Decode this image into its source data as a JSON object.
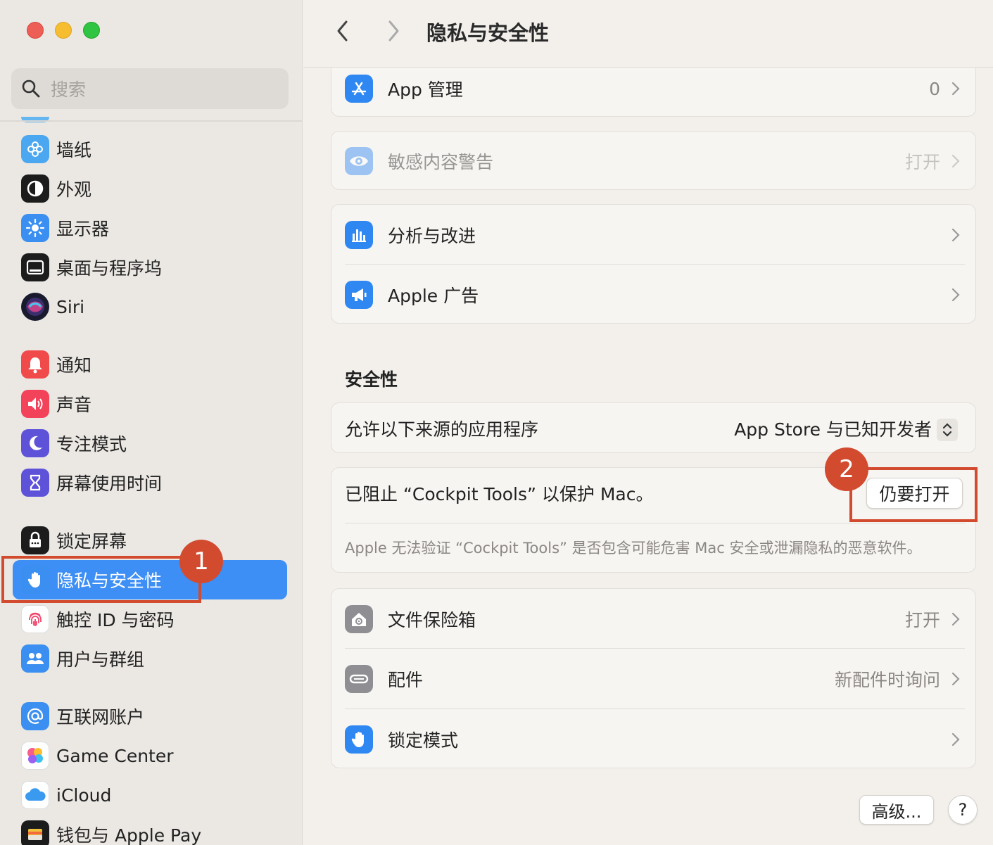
{
  "search": {
    "placeholder": "搜索"
  },
  "sidebar": {
    "items": [
      {
        "label": "墙纸",
        "icon": "wallpaper-icon",
        "color": "#4aa7f0"
      },
      {
        "label": "外观",
        "icon": "appearance-icon",
        "color": "#1c1c1c"
      },
      {
        "label": "显示器",
        "icon": "display-icon",
        "color": "#3a8ff0"
      },
      {
        "label": "桌面与程序坞",
        "icon": "desktop-dock-icon",
        "color": "#1c1c1c"
      },
      {
        "label": "Siri",
        "icon": "siri-icon",
        "color": "#2b2b40"
      },
      {
        "label": "通知",
        "icon": "bell-icon",
        "color": "#f04a4a"
      },
      {
        "label": "声音",
        "icon": "speaker-icon",
        "color": "#f2435a"
      },
      {
        "label": "专注模式",
        "icon": "moon-icon",
        "color": "#5e52d9"
      },
      {
        "label": "屏幕使用时间",
        "icon": "hourglass-icon",
        "color": "#5e52d9"
      },
      {
        "label": "锁定屏幕",
        "icon": "lock-icon",
        "color": "#1c1c1c"
      },
      {
        "label": "隐私与安全性",
        "icon": "hand-icon",
        "color": "#3a8ff0"
      },
      {
        "label": "触控 ID 与密码",
        "icon": "fingerprint-icon",
        "color": "#ffffff"
      },
      {
        "label": "用户与群组",
        "icon": "users-icon",
        "color": "#3a8ff0"
      },
      {
        "label": "互联网账户",
        "icon": "at-icon",
        "color": "#3a8ff0"
      },
      {
        "label": "Game Center",
        "icon": "game-center-icon",
        "color": "#ffffff"
      },
      {
        "label": "iCloud",
        "icon": "icloud-icon",
        "color": "#ffffff"
      },
      {
        "label": "钱包与 Apple Pay",
        "icon": "wallet-icon",
        "color": "#1c1c1c"
      }
    ]
  },
  "header": {
    "title": "隐私与安全性"
  },
  "rows": {
    "app_mgmt": {
      "label": "App 管理",
      "value": "0"
    },
    "sensitive": {
      "label": "敏感内容警告",
      "value": "打开"
    },
    "analytics": {
      "label": "分析与改进"
    },
    "apple_ads": {
      "label": "Apple 广告"
    },
    "file_vault": {
      "label": "文件保险箱",
      "value": "打开"
    },
    "accessories": {
      "label": "配件",
      "value": "新配件时询问"
    },
    "lockdown": {
      "label": "锁定模式"
    }
  },
  "security": {
    "title": "安全性",
    "allow_label": "允许以下来源的应用程序",
    "allow_value": "App Store 与已知开发者",
    "blocked_text": "已阻止 “Cockpit Tools” 以保护 Mac。",
    "open_anyway": "仍要打开",
    "hint": "Apple 无法验证 “Cockpit Tools” 是否包含可能危害 Mac 安全或泄漏隐私的恶意软件。"
  },
  "footer": {
    "advanced": "高级...",
    "help": "?"
  },
  "annotations": {
    "one": "1",
    "two": "2",
    "color": "#d24b2f"
  },
  "accent": "#3d8ef5"
}
